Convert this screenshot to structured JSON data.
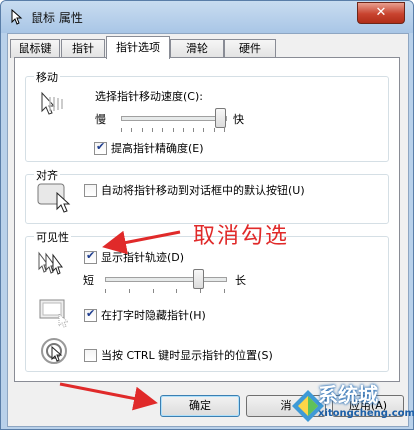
{
  "window": {
    "title": "鼠标 属性",
    "close_glyph": "✕"
  },
  "tabs": [
    {
      "label": "鼠标键",
      "active": false
    },
    {
      "label": "指针",
      "active": false
    },
    {
      "label": "指针选项",
      "active": true
    },
    {
      "label": "滑轮",
      "active": false
    },
    {
      "label": "硬件",
      "active": false
    }
  ],
  "motion": {
    "group_label": "移动",
    "speed_label": "选择指针移动速度(C):",
    "slow_label": "慢",
    "fast_label": "快",
    "speed_value": 1.0,
    "precision_label": "提高指针精确度(E)",
    "precision_checked": true
  },
  "snap": {
    "group_label": "对齐",
    "snap_label": "自动将指针移动到对话框中的默认按钮(U)",
    "snap_checked": false
  },
  "visibility": {
    "group_label": "可见性",
    "trails_label": "显示指针轨迹(D)",
    "trails_checked": true,
    "short_label": "短",
    "long_label": "长",
    "trails_value": 0.8,
    "hide_label": "在打字时隐藏指针(H)",
    "hide_checked": true,
    "ctrl_label": "当按 CTRL 键时显示指针的位置(S)",
    "ctrl_checked": false
  },
  "buttons": {
    "ok": "确定",
    "cancel": "消",
    "apply": "应用(A)"
  },
  "annotation": {
    "text": "取消勾选",
    "color": "#e02a2a"
  },
  "watermark": {
    "brand": "系统城",
    "url": "xitongcheng.com"
  },
  "colors": {
    "accent": "#3c7fb1",
    "checkmark": "#1e3d8f"
  }
}
